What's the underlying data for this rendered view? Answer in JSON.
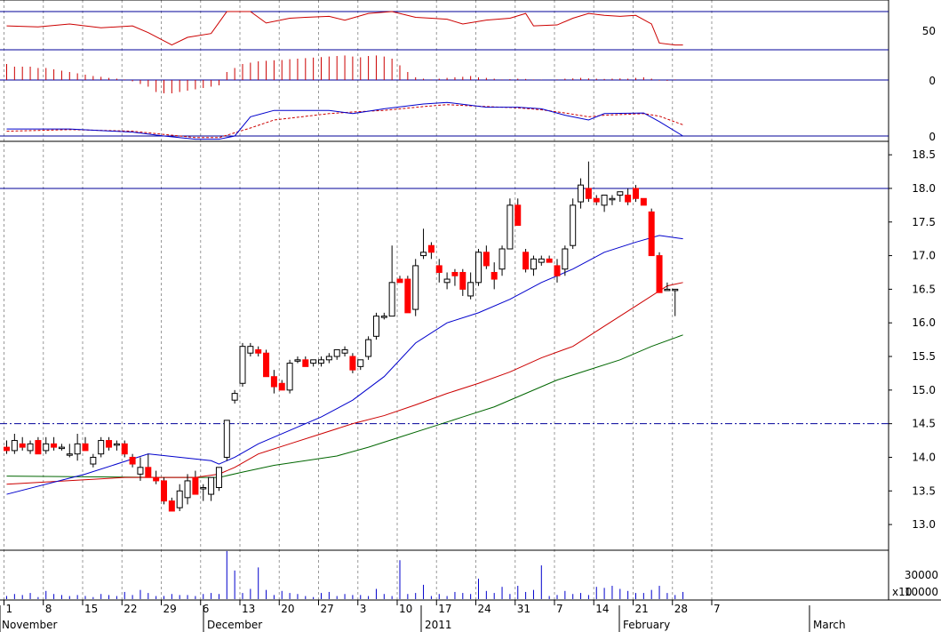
{
  "colors": {
    "up_fill": "#ffffff",
    "down_fill": "#ff0000",
    "candle_outline": "#000000",
    "ma20": "#0000cc",
    "ma50": "#cc0000",
    "ma100": "#006600",
    "grid": "#999999",
    "level": "#000099",
    "rsi": "#cc0000",
    "macd_line": "#0000cc",
    "macd_signal": "#cc0000",
    "hist": "#cc0000",
    "volume": "#0000cc"
  },
  "chart_data": {
    "type": "candlestick",
    "price_axis": {
      "ylim": [
        12.75,
        18.7
      ],
      "ticks": [
        "13.0",
        "13.5",
        "14.0",
        "14.5",
        "15.0",
        "15.5",
        "16.0",
        "16.5",
        "17.0",
        "17.5",
        "18.0",
        "18.5"
      ]
    },
    "reference_levels": [
      14.5,
      18.0
    ],
    "date_axis": {
      "ticks": [
        "1",
        "8",
        "15",
        "22",
        "29",
        "6",
        "13",
        "20",
        "27",
        "3",
        "10",
        "17",
        "24",
        "31",
        "7",
        "14",
        "21",
        "28",
        "7"
      ],
      "months": [
        "November",
        "December",
        "2011",
        "February",
        "March"
      ]
    },
    "candles": [
      [
        14.15,
        14.25,
        14.05,
        14.1
      ],
      [
        14.1,
        14.35,
        14.05,
        14.25
      ],
      [
        14.2,
        14.3,
        14.1,
        14.15
      ],
      [
        14.1,
        14.25,
        14.05,
        14.2
      ],
      [
        14.25,
        14.3,
        14.05,
        14.05
      ],
      [
        14.1,
        14.3,
        14.05,
        14.2
      ],
      [
        14.2,
        14.3,
        14.1,
        14.15
      ],
      [
        14.15,
        14.2,
        14.1,
        14.15
      ],
      [
        14.05,
        14.2,
        14.0,
        14.05
      ],
      [
        14.05,
        14.35,
        13.95,
        14.2
      ],
      [
        14.2,
        14.3,
        14.1,
        14.1
      ],
      [
        13.9,
        14.05,
        13.85,
        14.0
      ],
      [
        14.05,
        14.3,
        14.0,
        14.25
      ],
      [
        14.25,
        14.3,
        14.1,
        14.15
      ],
      [
        14.2,
        14.25,
        14.1,
        14.2
      ],
      [
        14.2,
        14.25,
        14.0,
        14.05
      ],
      [
        14.0,
        14.05,
        13.85,
        13.9
      ],
      [
        13.75,
        14.0,
        13.65,
        13.85
      ],
      [
        13.85,
        14.05,
        13.75,
        13.7
      ],
      [
        13.7,
        13.8,
        13.6,
        13.65
      ],
      [
        13.65,
        13.7,
        13.3,
        13.35
      ],
      [
        13.35,
        13.4,
        13.2,
        13.2
      ],
      [
        13.25,
        13.6,
        13.2,
        13.5
      ],
      [
        13.4,
        13.75,
        13.3,
        13.65
      ],
      [
        13.7,
        13.8,
        13.45,
        13.45
      ],
      [
        13.55,
        13.6,
        13.35,
        13.55
      ],
      [
        13.45,
        13.7,
        13.35,
        13.7
      ],
      [
        13.55,
        13.8,
        13.5,
        13.85
      ],
      [
        14.0,
        14.5,
        13.95,
        14.55
      ],
      [
        14.85,
        15.0,
        14.8,
        14.95
      ],
      [
        15.1,
        15.7,
        15.05,
        15.65
      ],
      [
        15.55,
        15.7,
        15.5,
        15.65
      ],
      [
        15.6,
        15.65,
        15.5,
        15.55
      ],
      [
        15.55,
        15.6,
        15.2,
        15.2
      ],
      [
        15.2,
        15.3,
        14.95,
        15.05
      ],
      [
        15.1,
        15.15,
        15.0,
        15.0
      ],
      [
        15.0,
        15.45,
        14.95,
        15.4
      ],
      [
        15.45,
        15.5,
        15.4,
        15.45
      ],
      [
        15.45,
        15.5,
        15.35,
        15.35
      ],
      [
        15.4,
        15.45,
        15.35,
        15.45
      ],
      [
        15.4,
        15.5,
        15.35,
        15.45
      ],
      [
        15.45,
        15.55,
        15.4,
        15.5
      ],
      [
        15.5,
        15.6,
        15.45,
        15.6
      ],
      [
        15.55,
        15.65,
        15.5,
        15.6
      ],
      [
        15.5,
        15.55,
        15.25,
        15.3
      ],
      [
        15.35,
        15.45,
        15.3,
        15.45
      ],
      [
        15.5,
        15.8,
        15.45,
        15.75
      ],
      [
        15.8,
        16.15,
        15.75,
        16.1
      ],
      [
        16.1,
        16.15,
        16.05,
        16.1
      ],
      [
        16.1,
        17.15,
        16.1,
        16.6
      ],
      [
        16.65,
        16.7,
        16.6,
        16.6
      ],
      [
        16.65,
        16.7,
        16.15,
        16.15
      ],
      [
        16.2,
        16.95,
        16.1,
        16.85
      ],
      [
        17.0,
        17.4,
        16.95,
        17.05
      ],
      [
        17.15,
        17.2,
        16.95,
        17.05
      ],
      [
        16.85,
        16.95,
        16.6,
        16.75
      ],
      [
        16.6,
        16.75,
        16.5,
        16.65
      ],
      [
        16.75,
        16.8,
        16.55,
        16.7
      ],
      [
        16.75,
        16.8,
        16.4,
        16.5
      ],
      [
        16.4,
        16.75,
        16.35,
        16.6
      ],
      [
        16.6,
        17.1,
        16.55,
        17.05
      ],
      [
        17.05,
        17.15,
        16.8,
        16.85
      ],
      [
        16.75,
        16.9,
        16.5,
        16.65
      ],
      [
        16.8,
        17.15,
        16.7,
        17.1
      ],
      [
        17.1,
        17.85,
        17.1,
        17.75
      ],
      [
        17.75,
        17.85,
        17.45,
        17.45
      ],
      [
        17.05,
        17.1,
        16.75,
        16.8
      ],
      [
        16.8,
        17.0,
        16.7,
        16.95
      ],
      [
        16.9,
        17.0,
        16.85,
        16.95
      ],
      [
        16.95,
        17.0,
        16.9,
        16.9
      ],
      [
        16.85,
        16.95,
        16.6,
        16.7
      ],
      [
        16.8,
        17.15,
        16.7,
        17.1
      ],
      [
        17.15,
        17.85,
        17.1,
        17.75
      ],
      [
        17.8,
        18.15,
        17.7,
        18.05
      ],
      [
        18.0,
        18.4,
        17.8,
        17.85
      ],
      [
        17.85,
        17.9,
        17.75,
        17.8
      ],
      [
        17.75,
        17.9,
        17.65,
        17.9
      ],
      [
        17.85,
        17.9,
        17.75,
        17.85
      ],
      [
        17.9,
        17.95,
        17.8,
        17.95
      ],
      [
        17.9,
        18.0,
        17.75,
        17.8
      ],
      [
        18.0,
        18.05,
        17.8,
        17.85
      ],
      [
        17.85,
        17.85,
        17.75,
        17.75
      ],
      [
        17.65,
        17.7,
        17.05,
        17.0
      ],
      [
        17.0,
        17.05,
        16.5,
        16.45
      ],
      [
        16.5,
        16.6,
        16.5,
        16.5
      ],
      [
        16.5,
        16.5,
        16.1,
        16.5
      ]
    ],
    "moving_averages": {
      "ma20": [
        [
          0,
          13.45
        ],
        [
          10,
          13.75
        ],
        [
          18,
          14.05
        ],
        [
          26,
          13.95
        ],
        [
          27,
          13.9
        ],
        [
          29,
          14.0
        ],
        [
          32,
          14.2
        ],
        [
          36,
          14.4
        ],
        [
          40,
          14.6
        ],
        [
          44,
          14.85
        ],
        [
          48,
          15.2
        ],
        [
          52,
          15.7
        ],
        [
          56,
          16.0
        ],
        [
          60,
          16.15
        ],
        [
          64,
          16.35
        ],
        [
          68,
          16.6
        ],
        [
          72,
          16.8
        ],
        [
          76,
          17.05
        ],
        [
          80,
          17.2
        ],
        [
          83,
          17.3
        ],
        [
          86,
          17.25
        ]
      ],
      "ma50": [
        [
          0,
          13.6
        ],
        [
          15,
          13.7
        ],
        [
          24,
          13.7
        ],
        [
          27,
          13.75
        ],
        [
          29,
          13.85
        ],
        [
          32,
          14.05
        ],
        [
          36,
          14.2
        ],
        [
          40,
          14.35
        ],
        [
          44,
          14.5
        ],
        [
          48,
          14.62
        ],
        [
          52,
          14.78
        ],
        [
          56,
          14.95
        ],
        [
          60,
          15.1
        ],
        [
          64,
          15.27
        ],
        [
          68,
          15.48
        ],
        [
          72,
          15.65
        ],
        [
          76,
          15.95
        ],
        [
          80,
          16.25
        ],
        [
          84,
          16.55
        ],
        [
          86,
          16.6
        ]
      ],
      "ma100": [
        [
          0,
          13.72
        ],
        [
          20,
          13.7
        ],
        [
          27,
          13.7
        ],
        [
          30,
          13.78
        ],
        [
          34,
          13.88
        ],
        [
          38,
          13.95
        ],
        [
          42,
          14.02
        ],
        [
          46,
          14.15
        ],
        [
          50,
          14.3
        ],
        [
          54,
          14.45
        ],
        [
          58,
          14.6
        ],
        [
          62,
          14.75
        ],
        [
          66,
          14.95
        ],
        [
          70,
          15.15
        ],
        [
          74,
          15.3
        ],
        [
          78,
          15.45
        ],
        [
          82,
          15.65
        ],
        [
          86,
          15.82
        ]
      ]
    },
    "rsi": {
      "axis_ticks": [
        "50"
      ],
      "levels": [
        70,
        30
      ],
      "values": [
        [
          0,
          55
        ],
        [
          4,
          54
        ],
        [
          8,
          57
        ],
        [
          12,
          53
        ],
        [
          16,
          55
        ],
        [
          18,
          48
        ],
        [
          21,
          35
        ],
        [
          23,
          43
        ],
        [
          26,
          47
        ],
        [
          28,
          70
        ],
        [
          31,
          70
        ],
        [
          33,
          58
        ],
        [
          36,
          63
        ],
        [
          38,
          64
        ],
        [
          41,
          65
        ],
        [
          43,
          61
        ],
        [
          46,
          68
        ],
        [
          49,
          70
        ],
        [
          52,
          64
        ],
        [
          54,
          63
        ],
        [
          56,
          62
        ],
        [
          58,
          57
        ],
        [
          61,
          61
        ],
        [
          64,
          63
        ],
        [
          66,
          68
        ],
        [
          67,
          55
        ],
        [
          70,
          56
        ],
        [
          72,
          63
        ],
        [
          74,
          68
        ],
        [
          76,
          66
        ],
        [
          78,
          65
        ],
        [
          80,
          66
        ],
        [
          82,
          57
        ],
        [
          83,
          37
        ],
        [
          85,
          35
        ],
        [
          86,
          35
        ]
      ]
    },
    "histogram": {
      "axis_ticks": [
        "0"
      ],
      "values": [
        0.6,
        0.5,
        0.5,
        0.5,
        0.45,
        0.45,
        0.4,
        0.35,
        0.3,
        0.25,
        0.2,
        0.15,
        0.12,
        0.08,
        0.05,
        0.02,
        -0.05,
        -0.15,
        -0.25,
        -0.45,
        -0.5,
        -0.5,
        -0.45,
        -0.4,
        -0.35,
        -0.3,
        -0.25,
        -0.2,
        0.3,
        0.45,
        0.6,
        0.65,
        0.7,
        0.72,
        0.74,
        0.75,
        0.78,
        0.8,
        0.82,
        0.84,
        0.86,
        0.88,
        0.9,
        0.92,
        0.88,
        0.85,
        0.9,
        0.92,
        0.88,
        0.8,
        0.55,
        0.3,
        0.1,
        0.05,
        0.02,
        0.05,
        0.08,
        0.1,
        0.12,
        0.15,
        0.1,
        0.08,
        0.05,
        0.02,
        0.03,
        0.05,
        0.04,
        0.02,
        0.01,
        0.0,
        0.02,
        0.05,
        0.06,
        0.08,
        0.06,
        0.05,
        0.04,
        0.05,
        0.06,
        0.05,
        0.08,
        0.1,
        0.05,
        -0.02,
        -0.03,
        0.02,
        0.0
      ]
    },
    "macd": {
      "axis_ticks": [
        "0"
      ],
      "line": [
        [
          0,
          0.22
        ],
        [
          8,
          0.22
        ],
        [
          16,
          0.12
        ],
        [
          20,
          0.0
        ],
        [
          24,
          -0.1
        ],
        [
          27,
          -0.1
        ],
        [
          29,
          0.0
        ],
        [
          31,
          0.6
        ],
        [
          34,
          0.8
        ],
        [
          41,
          0.8
        ],
        [
          44,
          0.7
        ],
        [
          48,
          0.85
        ],
        [
          53,
          1.0
        ],
        [
          56,
          1.05
        ],
        [
          61,
          0.9
        ],
        [
          65,
          0.9
        ],
        [
          68,
          0.85
        ],
        [
          71,
          0.65
        ],
        [
          74,
          0.5
        ],
        [
          76,
          0.7
        ],
        [
          81,
          0.72
        ],
        [
          83,
          0.45
        ],
        [
          86,
          0.0
        ]
      ],
      "signal": [
        [
          0,
          0.15
        ],
        [
          8,
          0.2
        ],
        [
          16,
          0.15
        ],
        [
          20,
          0.05
        ],
        [
          24,
          -0.05
        ],
        [
          27,
          -0.05
        ],
        [
          31,
          0.25
        ],
        [
          34,
          0.5
        ],
        [
          41,
          0.7
        ],
        [
          44,
          0.75
        ],
        [
          48,
          0.8
        ],
        [
          53,
          0.92
        ],
        [
          56,
          0.98
        ],
        [
          61,
          0.92
        ],
        [
          65,
          0.88
        ],
        [
          68,
          0.82
        ],
        [
          71,
          0.72
        ],
        [
          74,
          0.6
        ],
        [
          76,
          0.65
        ],
        [
          81,
          0.7
        ],
        [
          83,
          0.62
        ],
        [
          86,
          0.35
        ]
      ]
    },
    "volume": {
      "axis_ticks": [
        "30000",
        "10000"
      ],
      "axis_multiplier": "x10",
      "values": [
        3,
        5,
        4,
        6,
        2,
        8,
        5,
        4,
        3,
        4,
        3,
        2,
        5,
        4,
        3,
        7,
        4,
        9,
        6,
        3,
        3,
        5,
        4,
        4,
        3,
        5,
        6,
        5,
        47,
        28,
        6,
        10,
        31,
        9,
        4,
        8,
        6,
        5,
        3,
        2,
        6,
        7,
        3,
        5,
        4,
        4,
        3,
        10,
        5,
        3,
        38,
        5,
        6,
        14,
        3,
        5,
        3,
        7,
        6,
        5,
        20,
        8,
        6,
        12,
        5,
        13,
        7,
        9,
        33,
        3,
        4,
        8,
        5,
        6,
        4,
        12,
        11,
        13,
        10,
        8,
        6,
        6,
        9,
        13,
        6,
        4,
        7
      ]
    }
  }
}
